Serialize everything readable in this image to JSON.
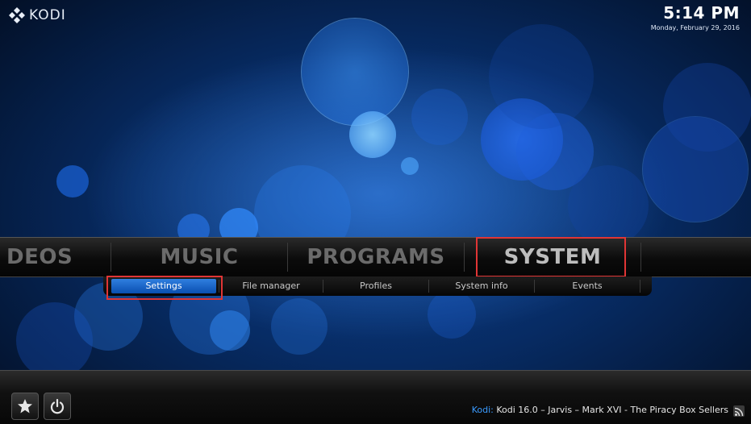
{
  "app": {
    "logo_text": "KODI"
  },
  "clock": {
    "time": "5:14 PM",
    "date": "Monday, February 29, 2016"
  },
  "main_menu": {
    "items": [
      {
        "label": "DEOS"
      },
      {
        "label": "MUSIC"
      },
      {
        "label": "PROGRAMS"
      },
      {
        "label": "SYSTEM",
        "selected": true
      }
    ]
  },
  "submenu": {
    "items": [
      {
        "label": "Settings",
        "selected": true
      },
      {
        "label": "File manager"
      },
      {
        "label": "Profiles"
      },
      {
        "label": "System info"
      },
      {
        "label": "Events"
      }
    ]
  },
  "bottom": {
    "favourites_icon": "star-icon",
    "power_icon": "power-icon",
    "rss_icon": "rss-icon",
    "ticker_label": "Kodi:",
    "ticker_text": "Kodi 16.0 – Jarvis – Mark XVI - The Piracy Box Sellers"
  },
  "colors": {
    "accent": "#3a9bff",
    "highlight_box": "#e03535",
    "selected_sub_item": "#1f6fd0"
  }
}
